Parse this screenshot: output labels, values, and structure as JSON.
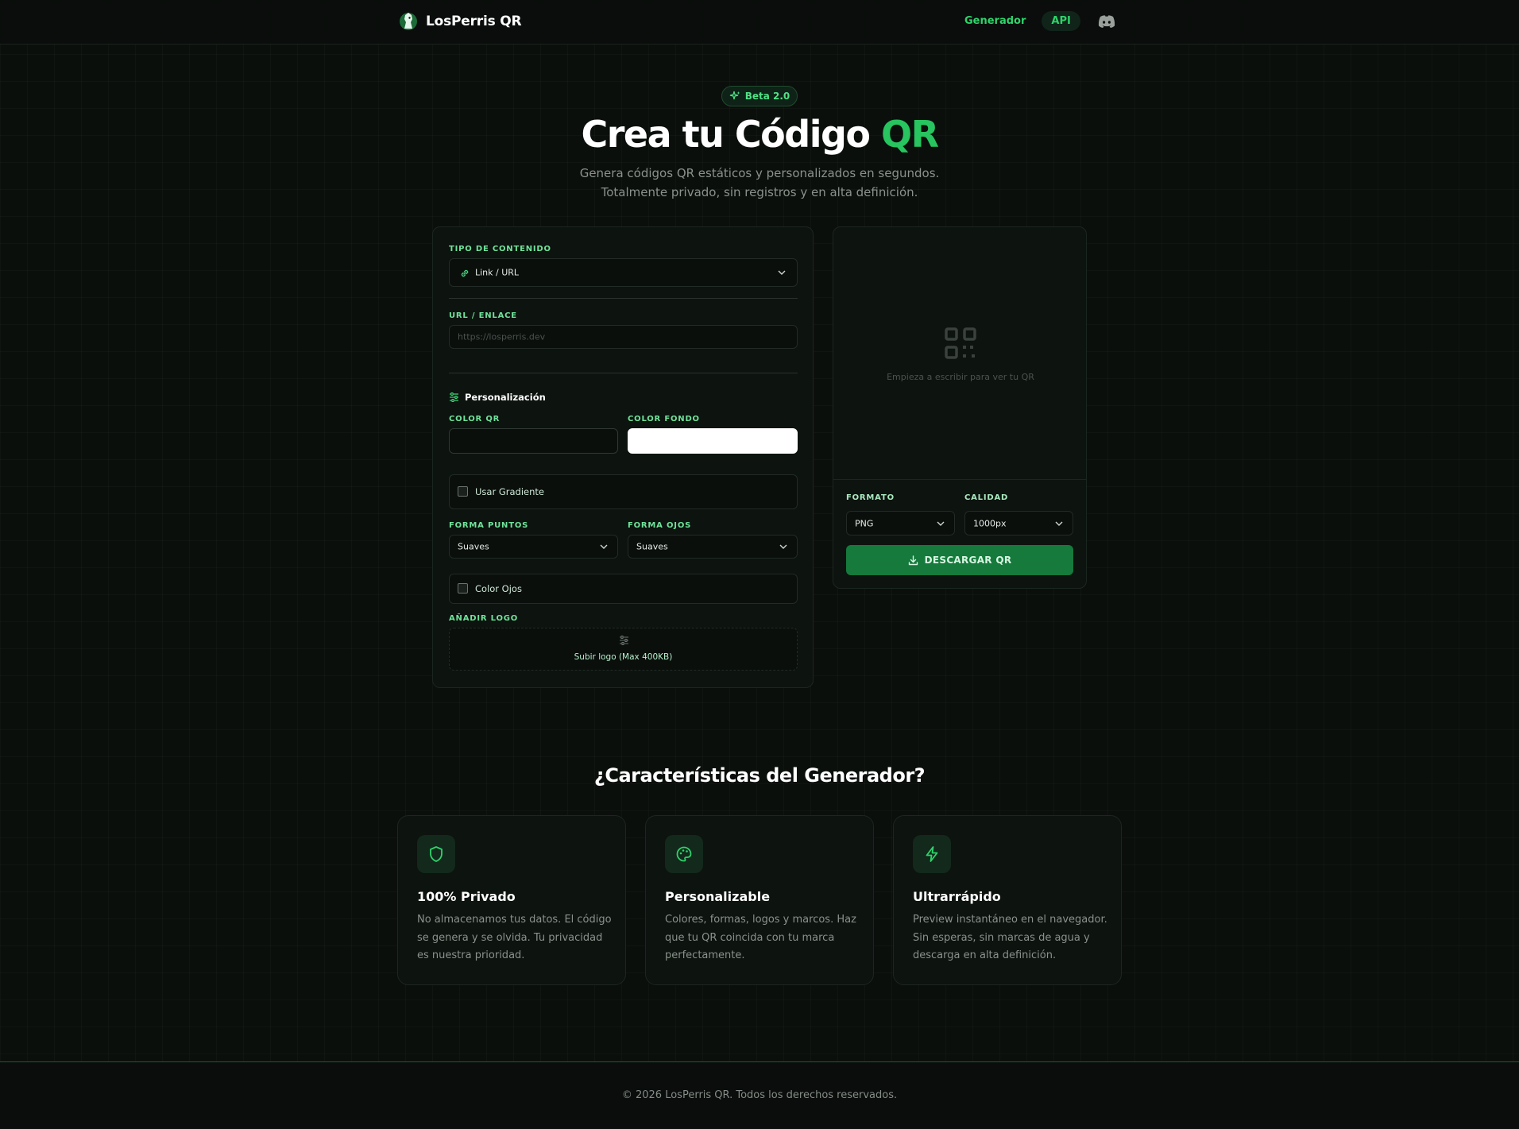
{
  "header": {
    "brand_name": "LosPerris QR",
    "nav": {
      "generator": "Generador",
      "api": "API"
    }
  },
  "hero": {
    "badge": "Beta 2.0",
    "title_main": "Crea tu Código",
    "title_accent": "QR",
    "subtitle": "Genera códigos QR estáticos y personalizados en segundos. Totalmente privado, sin registros y en alta definición."
  },
  "form": {
    "content_type_label": "TIPO DE CONTENIDO",
    "content_type_value": "Link / URL",
    "url_label": "URL / ENLACE",
    "url_placeholder": "https://losperris.dev",
    "customization_title": "Personalización",
    "color_qr_label": "COLOR QR",
    "color_qr_value": "#0a0f0c",
    "color_bg_label": "COLOR FONDO",
    "color_bg_value": "#ffffff",
    "gradient_label": "Usar Gradiente",
    "dots_label": "FORMA PUNTOS",
    "dots_value": "Suaves",
    "eyes_label": "FORMA OJOS",
    "eyes_value": "Suaves",
    "eye_color_label": "Color Ojos",
    "logo_label": "AÑADIR LOGO",
    "logo_upload": "Subir logo (Max 400KB)"
  },
  "preview": {
    "placeholder": "Empieza a escribir para ver tu QR",
    "format_label": "FORMATO",
    "format_value": "PNG",
    "quality_label": "CALIDAD",
    "quality_value": "1000px",
    "download_label": "DESCARGAR QR"
  },
  "features": {
    "title": "¿Características del Generador?",
    "items": [
      {
        "icon": "shield-icon",
        "name": "100% Privado",
        "desc": "No almacenamos tus datos. El código se genera y se olvida. Tu privacidad es nuestra prioridad."
      },
      {
        "icon": "palette-icon",
        "name": "Personalizable",
        "desc": "Colores, formas, logos y marcos. Haz que tu QR coincida con tu marca perfectamente."
      },
      {
        "icon": "zap-icon",
        "name": "Ultrarrápido",
        "desc": "Preview instantáneo en el navegador. Sin esperas, sin marcas de agua y descarga en alta definición."
      }
    ]
  },
  "footer": {
    "text": "© 2026 LosPerris QR. Todos los derechos reservados."
  },
  "colors": {
    "accent": "#27c45f",
    "download_button": "#157a3c",
    "background": "#0b0f0c"
  }
}
